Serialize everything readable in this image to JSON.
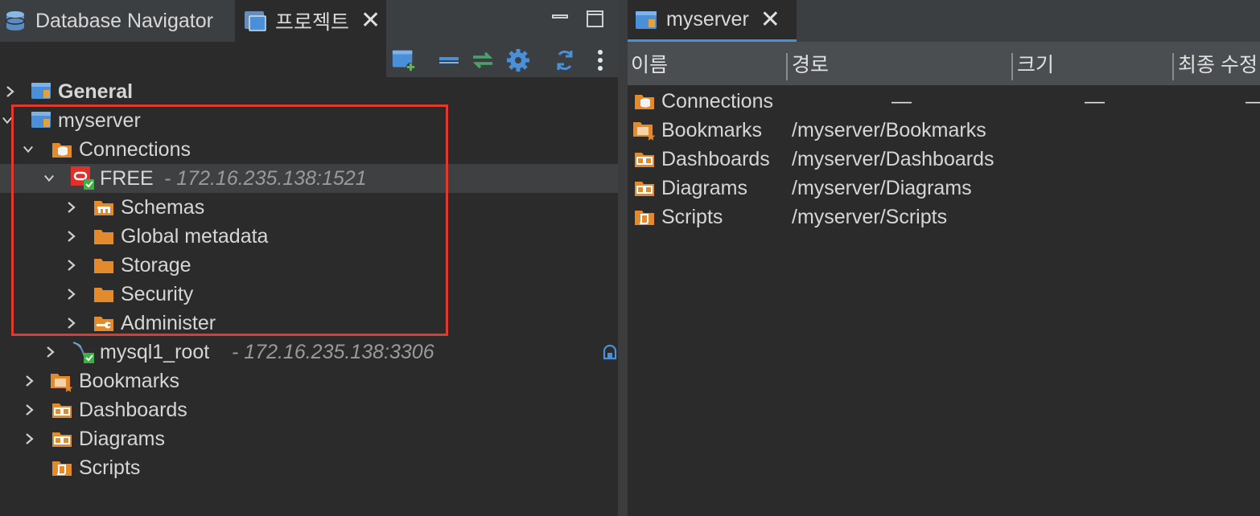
{
  "left_tabs": [
    {
      "label": "Database Navigator"
    },
    {
      "label": "프로젝트",
      "close": "✕"
    }
  ],
  "window_controls": {
    "minimize": "▭",
    "maximize": "▢"
  },
  "tree": {
    "general": {
      "label": "General"
    },
    "myserver": {
      "label": "myserver"
    },
    "connections": {
      "label": "Connections"
    },
    "free": {
      "label": "FREE",
      "detail": "- 172.16.235.138:1521"
    },
    "schemas": {
      "label": "Schemas"
    },
    "global_metadata": {
      "label": "Global metadata"
    },
    "storage": {
      "label": "Storage"
    },
    "security": {
      "label": "Security"
    },
    "administer": {
      "label": "Administer"
    },
    "mysql1_root": {
      "label": "mysql1_root",
      "detail": "- 172.16.235.138:3306"
    },
    "bookmarks": {
      "label": "Bookmarks"
    },
    "dashboards": {
      "label": "Dashboards"
    },
    "diagrams": {
      "label": "Diagrams"
    },
    "scripts": {
      "label": "Scripts"
    }
  },
  "right_tab": {
    "label": "myserver",
    "close": "✕"
  },
  "columns": {
    "name": "이름",
    "path": "경로",
    "size": "크기",
    "modified": "최종 수정"
  },
  "rows": [
    {
      "name": "Connections",
      "path": "",
      "size": "—",
      "modified": "—",
      "extra": "—"
    },
    {
      "name": "Bookmarks",
      "path": "/myserver/Bookmarks"
    },
    {
      "name": "Dashboards",
      "path": "/myserver/Dashboards"
    },
    {
      "name": "Diagrams",
      "path": "/myserver/Diagrams"
    },
    {
      "name": "Scripts",
      "path": "/myserver/Scripts"
    }
  ],
  "colors": {
    "folder": "#e38b2c",
    "highlight": "#e03a2e",
    "project": "#4a90d9"
  }
}
